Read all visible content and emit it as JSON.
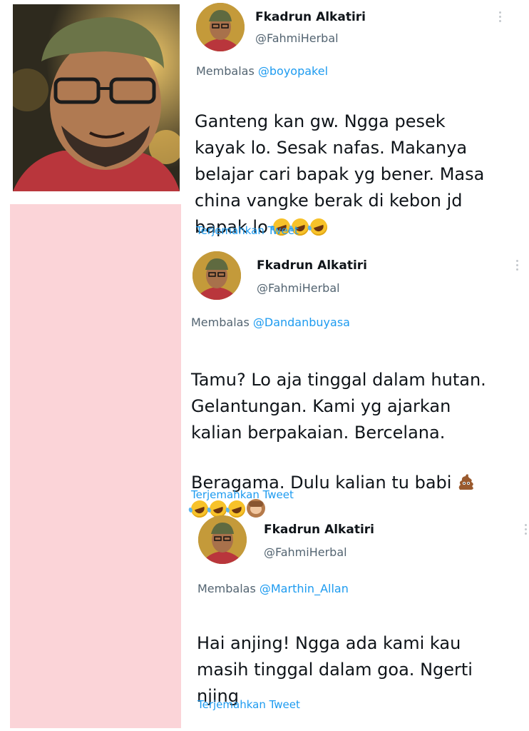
{
  "tweets": [
    {
      "name": "Fkadrun Alkatiri",
      "handle": "@FahmiHerbal",
      "reply_prefix": "Membalas",
      "reply_to": "@boyopakel",
      "text": "Ganteng kan gw. Ngga pesek\nkayak lo. Sesak nafas. Makanya\nbelajar cari bapak yg bener. Masa\nchina vangke berak di kebon jd\nbapak lo",
      "emojis": [
        "rolling-on-floor-laughing",
        "rolling-on-floor-laughing",
        "rolling-on-floor-laughing"
      ],
      "translate_label": "Terjemahkan Tweet"
    },
    {
      "name": "Fkadrun Alkatiri",
      "handle": "@FahmiHerbal",
      "reply_prefix": "Membalas",
      "reply_to": "@Dandanbuyasa",
      "text": "Tamu? Lo aja tinggal dalam hutan.\nGelantungan. Kami yg ajarkan\nkalian berpakaian. Bercelana.\nBeragama.  Dulu kalian tu babi",
      "emojis": [
        "pile-of-poo",
        "rolling-on-floor-laughing",
        "rolling-on-floor-laughing",
        "rolling-on-floor-laughing",
        "see-no-evil-monkey"
      ],
      "translate_label": "Terjemahkan Tweet"
    },
    {
      "name": "Fkadrun Alkatiri",
      "handle": "@FahmiHerbal",
      "reply_prefix": "Membalas",
      "reply_to": "@Marthin_Allan",
      "text": "Hai anjing! Ngga ada kami kau\nmasih tinggal dalam goa. Ngerti\nnjing",
      "emojis": [],
      "translate_label": "Terjemahkan Tweet"
    }
  ],
  "colors": {
    "text": "#0f1419",
    "secondary": "#536471",
    "link": "#1d9bf0",
    "pink_panel": "#fbd4d8"
  }
}
